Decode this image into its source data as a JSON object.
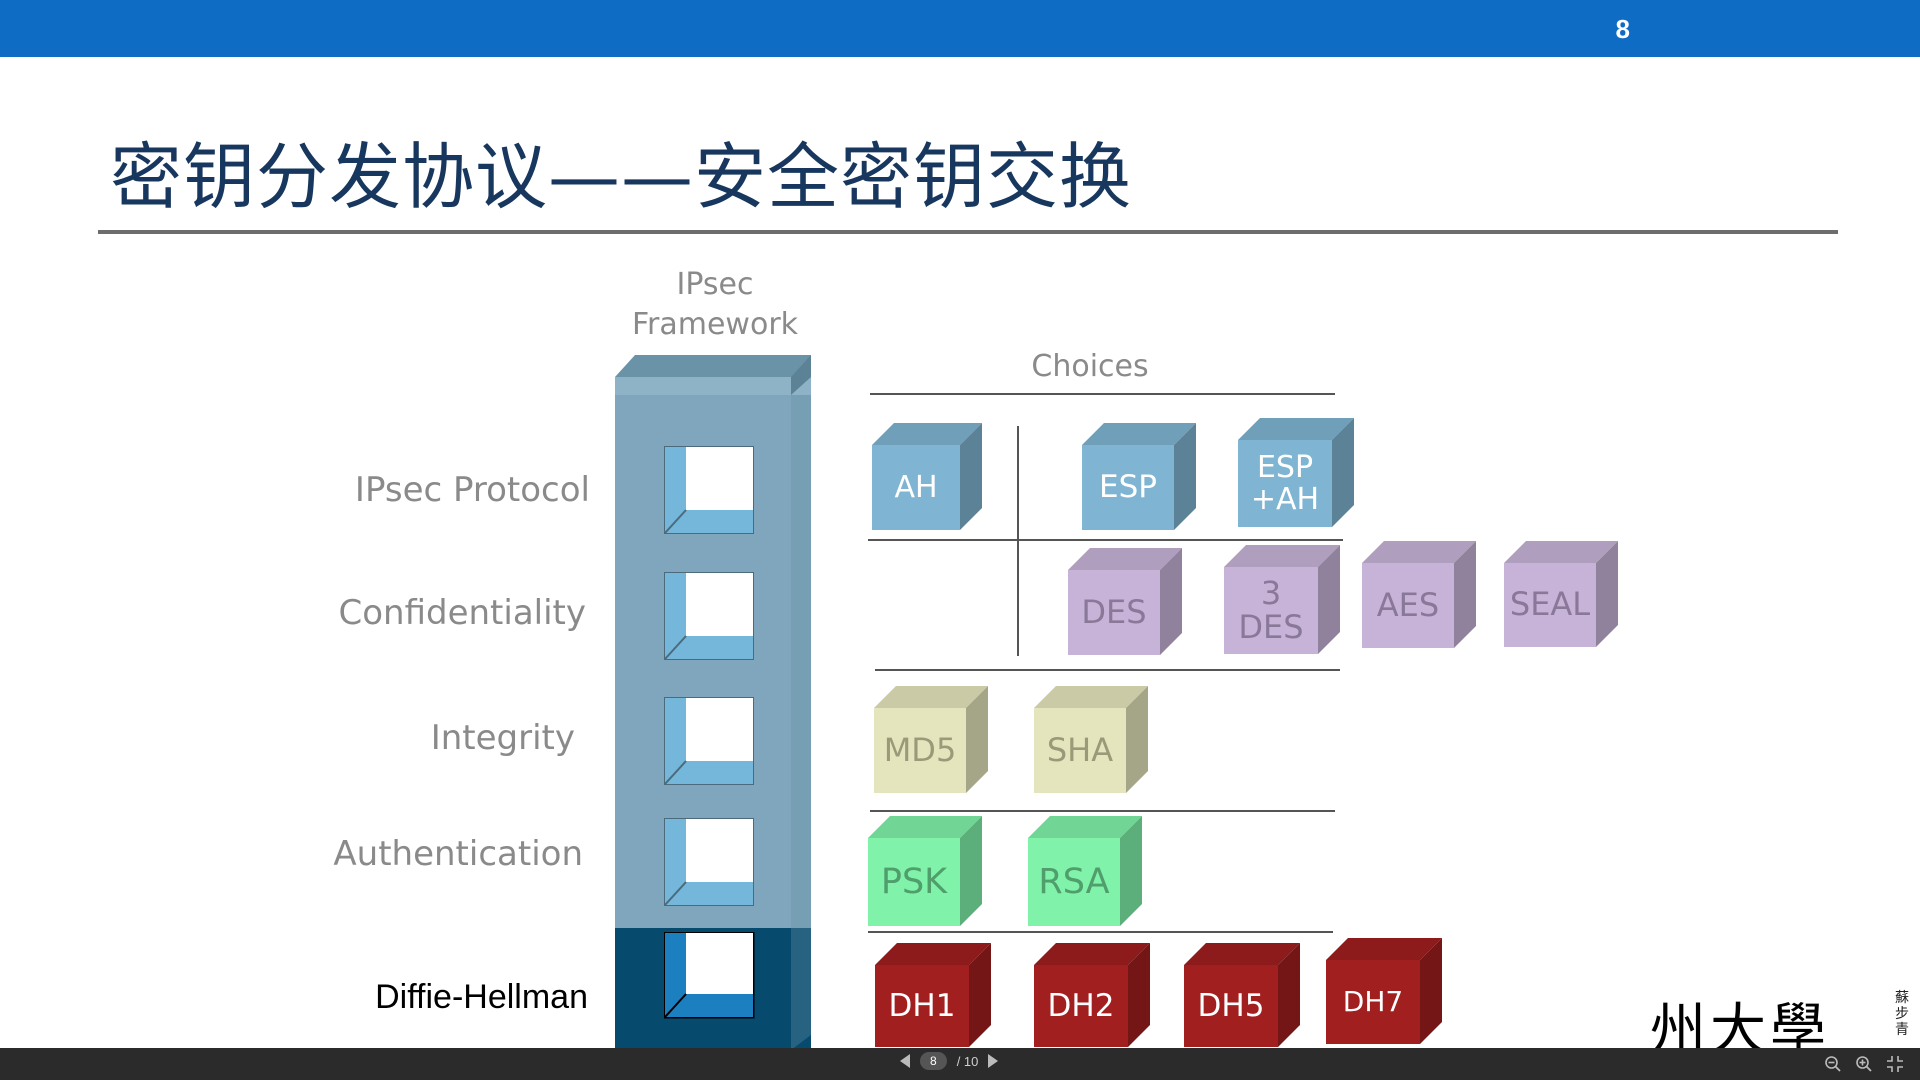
{
  "header": {
    "page_number": "8"
  },
  "title": "密钥分发协议——安全密钥交换",
  "diagram": {
    "framework_header": [
      "IPsec",
      "Framework"
    ],
    "choices_header": "Choices",
    "rows": [
      {
        "label": "IPsec Protocol",
        "dark": false
      },
      {
        "label": "Confidentiality",
        "dark": false
      },
      {
        "label": "Integrity",
        "dark": false
      },
      {
        "label": "Authentication",
        "dark": false
      },
      {
        "label": "Diffie-Hellman",
        "dark": true
      }
    ],
    "choices": {
      "ah": "AH",
      "esp": "ESP",
      "esp_ah": [
        "ESP",
        "+AH"
      ],
      "des": "DES",
      "des3": [
        "3",
        "DES"
      ],
      "aes": "AES",
      "seal": "SEAL",
      "md5": "MD5",
      "sha": "SHA",
      "psk": "PSK",
      "rsa": "RSA",
      "dh1": "DH1",
      "dh2": "DH2",
      "dh5": "DH5",
      "dh7": "DH7"
    },
    "colors": {
      "protocol": "#7fb5d2",
      "confidentiality": "#c8b3d8",
      "integrity": "#e5e5bd",
      "authentication": "#80f2a9",
      "dh": "#a11f1f",
      "tower": "#7fa6bc",
      "tower_dark": "#064a6e"
    }
  },
  "logo": {
    "text": "州大學",
    "seal": "蘇步青"
  },
  "pager": {
    "current": "8",
    "total": "/ 10"
  }
}
